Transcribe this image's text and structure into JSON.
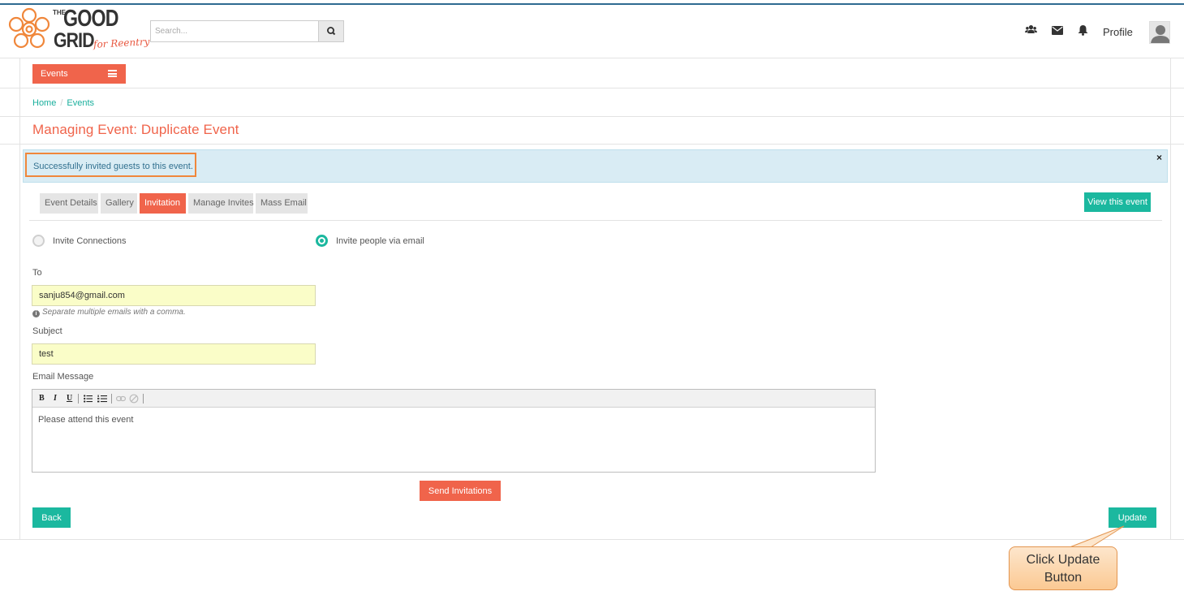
{
  "logo": {
    "line1_small": "THE",
    "line1": "GOOD",
    "line2": "GRID",
    "tagline": "for Reentry"
  },
  "header": {
    "search_placeholder": "Search...",
    "profile_label": "Profile"
  },
  "events_menu_label": "Events",
  "breadcrumb": {
    "home": "Home",
    "separator": "/",
    "current": "Events"
  },
  "page_title": "Managing Event: Duplicate Event",
  "alert": {
    "message": "Successfully invited guests to this event.",
    "close": "×"
  },
  "tabs": [
    {
      "label": "Event Details",
      "active": false
    },
    {
      "label": "Gallery",
      "active": false
    },
    {
      "label": "Invitation",
      "active": true
    },
    {
      "label": "Manage Invites",
      "active": false
    },
    {
      "label": "Mass Email",
      "active": false
    }
  ],
  "view_event_label": "View this event",
  "invite_options": [
    {
      "label": "Invite Connections",
      "selected": false
    },
    {
      "label": "Invite people via email",
      "selected": true
    }
  ],
  "form": {
    "to_label": "To",
    "to_value": "sanju854@gmail.com",
    "to_help": "Separate multiple emails with a comma.",
    "subject_label": "Subject",
    "subject_value": "test",
    "message_label": "Email Message",
    "message_value": "Please attend this event",
    "toolbar": {
      "bold": "B",
      "italic": "I",
      "underline": "U"
    }
  },
  "send_label": "Send Invitations",
  "back_label": "Back",
  "update_label": "Update",
  "callout": {
    "line1": "Click Update",
    "line2": "Button"
  },
  "colors": {
    "accent": "#f0644b",
    "teal": "#1bb89f",
    "alert_bg": "#d9ecf4",
    "highlight": "#f0873b"
  },
  "icons": [
    "search-icon",
    "users-icon",
    "envelope-icon",
    "bell-icon",
    "user-avatar-icon",
    "menu-icon",
    "close-icon",
    "info-icon",
    "bulleted-list-icon",
    "numbered-list-icon",
    "link-icon",
    "unlink-icon"
  ]
}
